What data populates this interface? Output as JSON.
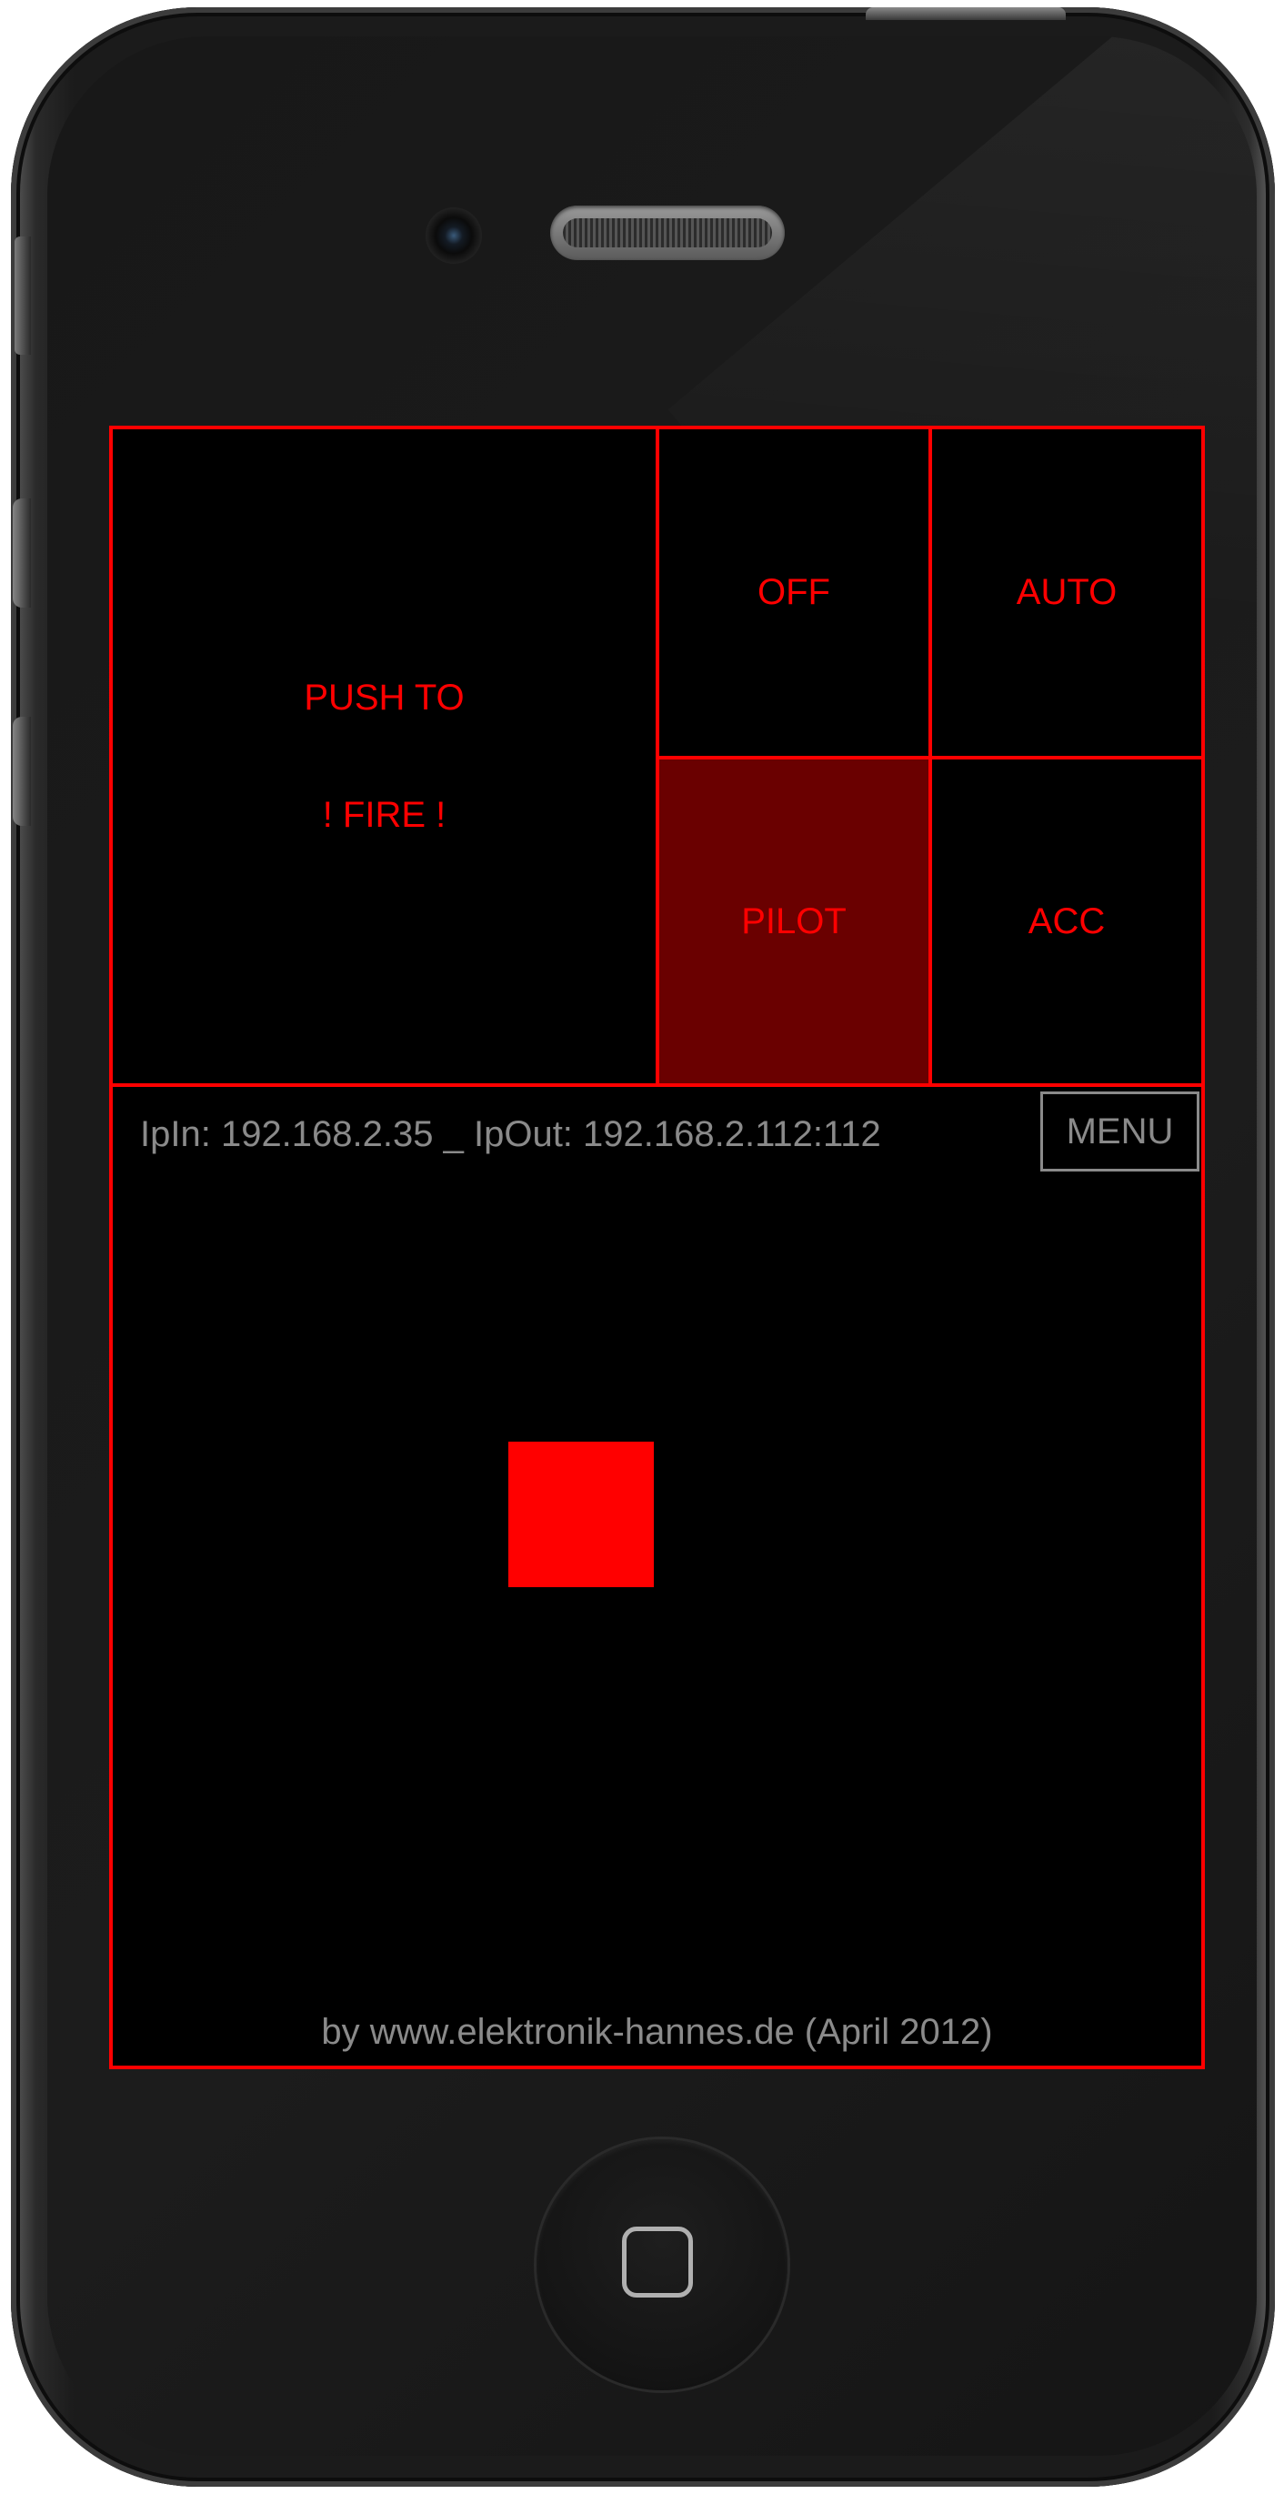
{
  "app": {
    "controls": {
      "fire_line1": "PUSH TO",
      "fire_line2": "! FIRE !",
      "off_label": "OFF",
      "auto_label": "AUTO",
      "pilot_label": "PILOT",
      "acc_label": "ACC",
      "active_mode": "PILOT"
    },
    "status": {
      "ip_text": "IpIn: 192.168.2.35 _ IpOut: 192.168.2.112:112",
      "menu_label": "MENU"
    },
    "footer": {
      "credit": "by www.elektronik-hannes.de (April 2012)"
    }
  },
  "colors": {
    "accent": "#ff0000",
    "active_bg": "#6a0000",
    "muted_text": "#8a8a8a",
    "screen_bg": "#000000"
  },
  "icons": {
    "home_button": "home-square-icon",
    "camera": "front-camera-icon",
    "speaker": "speaker-grille-icon"
  }
}
